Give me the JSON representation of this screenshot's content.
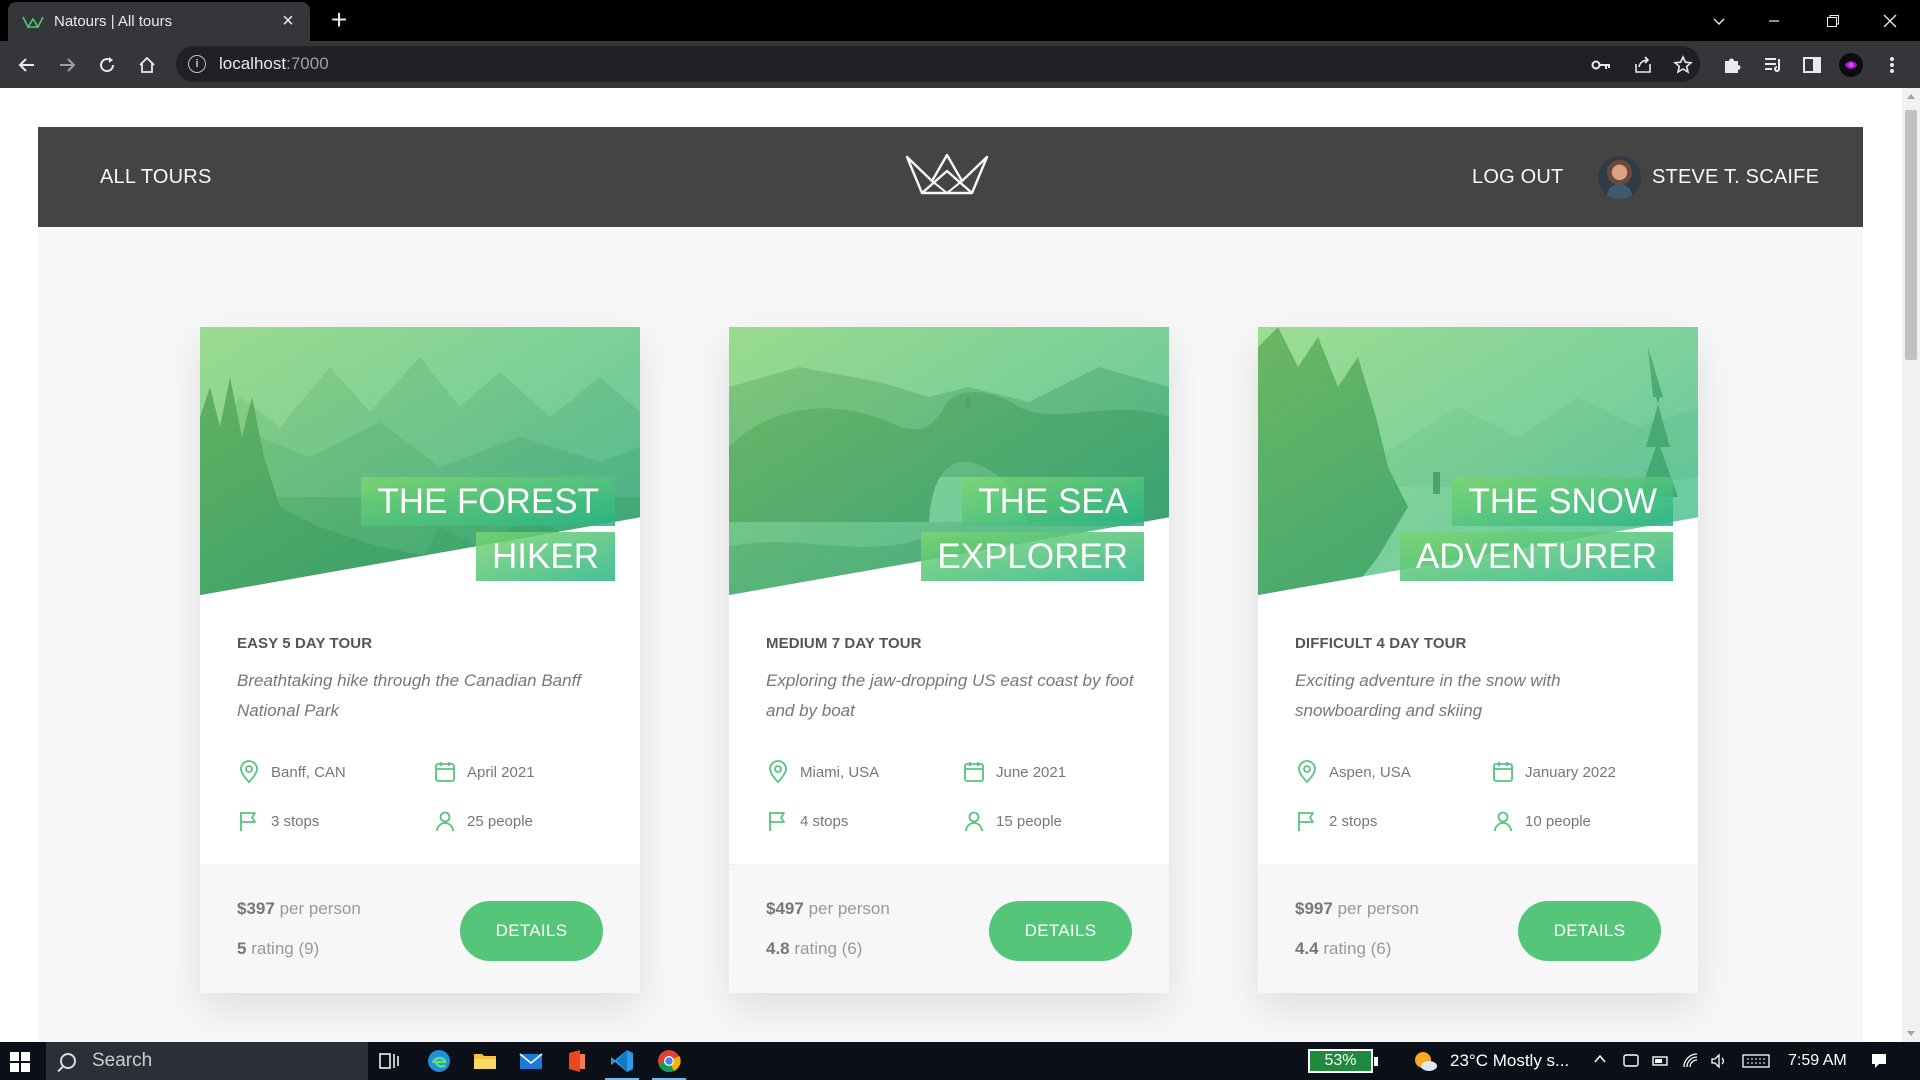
{
  "browser": {
    "tab_title": "Natours | All tours",
    "tab_close": "×",
    "new_tab": "+",
    "url_host": "localhost",
    "url_port": ":7000"
  },
  "header": {
    "all_tours": "ALL TOURS",
    "logout": "LOG OUT",
    "user_name": "STEVE T. SCAIFE"
  },
  "cards": [
    {
      "title_line1": "THE FOREST",
      "title_line2": "HIKER",
      "subheading": "EASY 5 DAY TOUR",
      "description": "Breathtaking hike through the Canadian Banff National Park",
      "location": "Banff, CAN",
      "date": "April 2021",
      "stops": "3 stops",
      "people": "25 people",
      "price": "$397",
      "price_unit": "per person",
      "rating_value": "5",
      "rating_label": "rating (9)",
      "button": "DETAILS",
      "scene": "forest"
    },
    {
      "title_line1": "THE SEA",
      "title_line2": "EXPLORER",
      "subheading": "MEDIUM 7 DAY TOUR",
      "description": "Exploring the jaw-dropping US east coast by foot and by boat",
      "location": "Miami, USA",
      "date": "June 2021",
      "stops": "4 stops",
      "people": "15 people",
      "price": "$497",
      "price_unit": "per person",
      "rating_value": "4.8",
      "rating_label": "rating (6)",
      "button": "DETAILS",
      "scene": "sea"
    },
    {
      "title_line1": "THE SNOW",
      "title_line2": "ADVENTURER",
      "subheading": "DIFFICULT 4 DAY TOUR",
      "description": "Exciting adventure in the snow with snowboarding and skiing",
      "location": "Aspen, USA",
      "date": "January 2022",
      "stops": "2 stops",
      "people": "10 people",
      "price": "$997",
      "price_unit": "per person",
      "rating_value": "4.4",
      "rating_label": "rating (6)",
      "button": "DETAILS",
      "scene": "snow"
    }
  ],
  "taskbar": {
    "search_label": "Search",
    "battery": "53%",
    "weather": "23°C  Mostly s...",
    "time": "7:59 AM"
  },
  "colors": {
    "brand_green": "#55c57a",
    "header_bg": "#444444",
    "page_bg": "#f7f7f7"
  },
  "icons": [
    "map-pin-icon",
    "calendar-icon",
    "flag-icon",
    "user-icon",
    "natours-logo"
  ]
}
